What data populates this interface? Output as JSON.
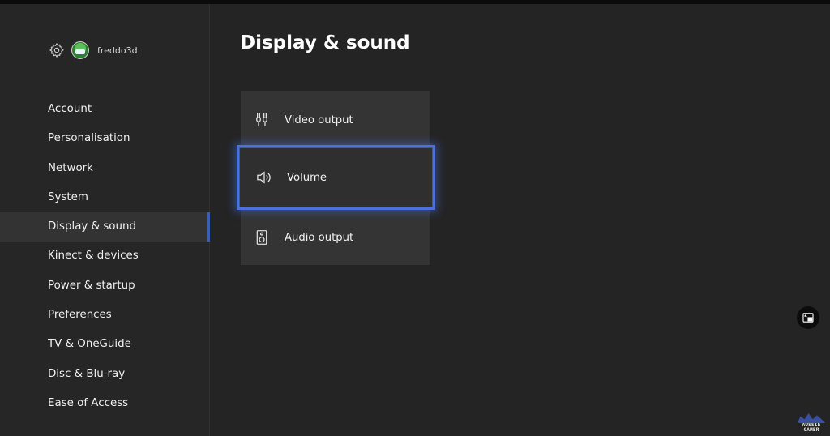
{
  "profile": {
    "gamertag": "freddo3d"
  },
  "sidebar": {
    "items": [
      {
        "label": "Account"
      },
      {
        "label": "Personalisation"
      },
      {
        "label": "Network"
      },
      {
        "label": "System"
      },
      {
        "label": "Display & sound",
        "selected": true
      },
      {
        "label": "Kinect & devices"
      },
      {
        "label": "Power & startup"
      },
      {
        "label": "Preferences"
      },
      {
        "label": "TV & OneGuide"
      },
      {
        "label": "Disc & Blu-ray"
      },
      {
        "label": "Ease of Access"
      }
    ]
  },
  "main": {
    "title": "Display & sound",
    "options": [
      {
        "label": "Video output",
        "icon": "video-output-icon"
      },
      {
        "label": "Volume",
        "icon": "speaker-volume-icon",
        "focused": true
      },
      {
        "label": "Audio output",
        "icon": "audio-speaker-icon"
      }
    ]
  },
  "watermark": {
    "line1": "AUSSIE",
    "line2": "GAMER"
  },
  "colors": {
    "background": "#242424",
    "sidebar": "#262626",
    "tile": "#343434",
    "focus": "#4a72d8",
    "selected_indicator": "#3b5fb0"
  }
}
